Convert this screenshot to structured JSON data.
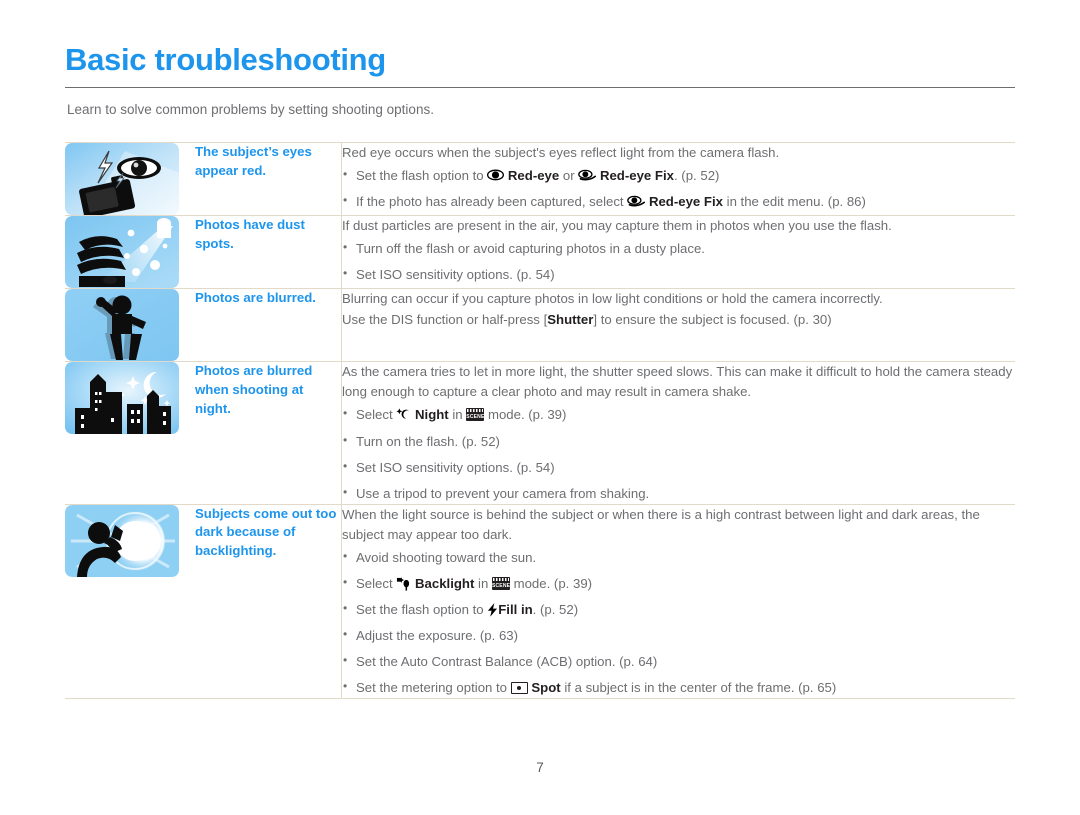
{
  "header": {
    "title": "Basic troubleshooting",
    "subtitle": "Learn to solve common problems by setting shooting options.",
    "title_color": "#1e95ed"
  },
  "footer": {
    "page_number": "7"
  },
  "rows": [
    {
      "thumb_icon": "camera-flash-redeye-icon",
      "label": "The subject’s eyes appear red.",
      "lead": "Red eye occurs when the subject's eyes reflect light from the camera flash.",
      "options": [
        {
          "pre": "Set the flash option to ",
          "icon1": "red-eye-icon",
          "bold1": "Red-eye",
          "mid": " or ",
          "icon2": "red-eye-fix-icon",
          "bold2": "Red-eye Fix",
          "post": ". (p. 52)"
        },
        {
          "pre": "If the photo has already been captured, select ",
          "icon1": "red-eye-fix-icon",
          "bold1": "Red-eye Fix",
          "post": " in the edit menu. (p. 86)"
        }
      ]
    },
    {
      "thumb_icon": "dust-spots-icon",
      "label": "Photos have dust spots.",
      "lead": "If dust particles are present in the air, you may capture them in photos when you use the flash.",
      "options": [
        {
          "pre": "Turn off the flash or avoid capturing photos in a dusty place."
        },
        {
          "pre": "Set ISO sensitivity options. (p. 54)"
        }
      ]
    },
    {
      "thumb_icon": "blurred-person-icon",
      "label": "Photos are blurred.",
      "lead": "Blurring can occur if you capture photos in low light conditions or hold the camera incorrectly.",
      "lead2_pre": "Use the DIS function or half-press [",
      "lead2_bold": "Shutter",
      "lead2_post": "] to ensure the subject is focused. (p. 30)",
      "options": []
    },
    {
      "thumb_icon": "night-city-icon",
      "label": "Photos are blurred when shooting at night.",
      "lead": "As the camera tries to let in more light, the shutter speed slows. This can make it difficult to hold the camera steady long enough to capture a clear photo and may result in camera shake.",
      "options": [
        {
          "pre": "Select ",
          "icon1": "night-mode-icon",
          "bold1": "Night",
          "mid": " in ",
          "icon2": "scene-mode-icon",
          "post": " mode. (p. 39)"
        },
        {
          "pre": "Turn on the flash. (p. 52)"
        },
        {
          "pre": "Set ISO sensitivity options. (p. 54)"
        },
        {
          "pre": "Use a tripod to prevent your camera from shaking."
        }
      ]
    },
    {
      "thumb_icon": "backlit-subject-icon",
      "label": "Subjects come out too dark because of backlighting.",
      "lead": "When the light source is behind the subject or when there is a high contrast between light and dark areas, the subject may appear too dark.",
      "options": [
        {
          "pre": "Avoid shooting toward the sun."
        },
        {
          "pre": "Select ",
          "icon1": "backlight-mode-icon",
          "bold1": "Backlight",
          "mid": " in ",
          "icon2": "scene-mode-icon",
          "post": " mode. (p. 39)"
        },
        {
          "pre": "Set the flash option to ",
          "icon1": "fill-in-flash-icon",
          "bold1": "Fill in",
          "post": ". (p. 52)"
        },
        {
          "pre": "Adjust the exposure. (p. 63)"
        },
        {
          "pre": "Set the Auto Contrast Balance (ACB) option. (p. 64)"
        },
        {
          "pre": "Set the metering option to ",
          "icon1": "spot-metering-icon",
          "bold1": "Spot",
          "post": " if a subject is in the center of the frame. (p. 65)"
        }
      ]
    }
  ],
  "scene_icon_text": "SCENE"
}
